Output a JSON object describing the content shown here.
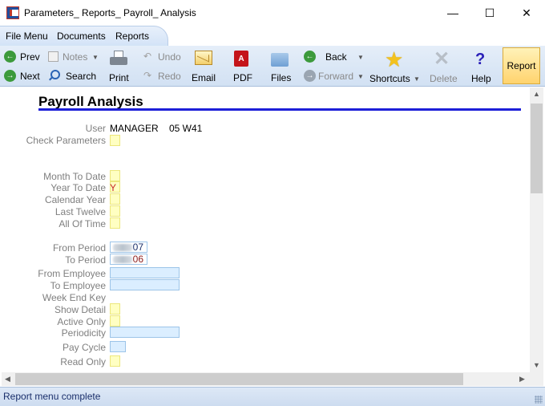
{
  "window": {
    "title": "Parameters_ Reports_ Payroll_ Analysis",
    "controls": [
      "minimize",
      "maximize",
      "close"
    ]
  },
  "menu": {
    "items": [
      "File Menu",
      "Documents",
      "Reports"
    ]
  },
  "toolbar": {
    "prev": "Prev",
    "next": "Next",
    "notes": "Notes",
    "search": "Search",
    "print": "Print",
    "undo": "Undo",
    "redo": "Redo",
    "email": "Email",
    "pdf": "PDF",
    "files": "Files",
    "back": "Back",
    "forward": "Forward",
    "shortcuts": "Shortcuts",
    "delete": "Delete",
    "help": "Help",
    "report": "Report",
    "icons": {
      "prev": "arrow-left-icon",
      "next": "arrow-right-icon",
      "notes": "notes-icon",
      "search": "search-icon",
      "print": "printer-icon",
      "undo": "undo-icon",
      "redo": "redo-icon",
      "email": "envelope-icon",
      "pdf": "pdf-icon",
      "files": "folder-icon",
      "back": "back-arrow-icon",
      "forward": "forward-arrow-icon",
      "shortcuts": "star-icon",
      "delete": "x-icon",
      "help": "question-icon"
    },
    "report_color": "#ffd36e"
  },
  "page": {
    "title": "Payroll Analysis",
    "title_rule_color": "#1d1fd8"
  },
  "form": {
    "user_label": "User",
    "user_value": "MANAGER",
    "user_week": "05 W41",
    "check_parameters_label": "Check Parameters",
    "month_to_date_label": "Month To Date",
    "year_to_date_label": "Year To Date",
    "year_to_date_value": "Y",
    "calendar_year_label": "Calendar Year",
    "last_twelve_label": "Last Twelve",
    "all_of_time_label": "All Of Time",
    "from_period_label": "From Period",
    "from_period_value": "07",
    "to_period_label": "To Period",
    "to_period_value": "06",
    "from_employee_label": "From Employee",
    "to_employee_label": "To Employee",
    "week_end_key_label": "Week End Key",
    "show_detail_label": "Show Detail",
    "active_only_label": "Active Only",
    "periodicity_label": "Periodicity",
    "pay_cycle_label": "Pay Cycle",
    "read_only_label": "Read Only"
  },
  "status": {
    "text": "Report menu complete"
  }
}
